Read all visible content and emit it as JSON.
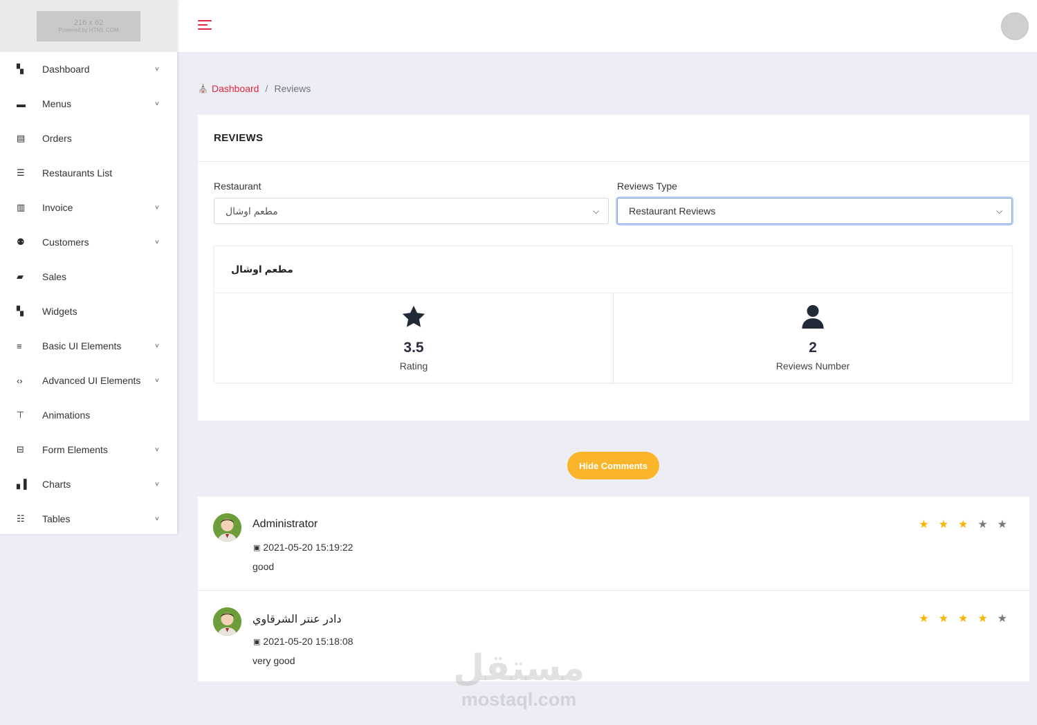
{
  "logo": {
    "line1": "216 x 62",
    "line2": "Powered by HTML.COM"
  },
  "sidebar": {
    "items": [
      {
        "label": "Dashboard",
        "icon": "dashboard-icon",
        "glyph": "▚",
        "chevron": true
      },
      {
        "label": "Menus",
        "icon": "archive-icon",
        "glyph": "▬",
        "chevron": true
      },
      {
        "label": "Orders",
        "icon": "clipboard-icon",
        "glyph": "▤",
        "chevron": false
      },
      {
        "label": "Restaurants List",
        "icon": "list-check-icon",
        "glyph": "☰",
        "chevron": false
      },
      {
        "label": "Invoice",
        "icon": "file-invoice-icon",
        "glyph": "▥",
        "chevron": true
      },
      {
        "label": "Customers",
        "icon": "users-icon",
        "glyph": "⚉",
        "chevron": true
      },
      {
        "label": "Sales",
        "icon": "briefcase-icon",
        "glyph": "▰",
        "chevron": false
      },
      {
        "label": "Widgets",
        "icon": "widgets-icon",
        "glyph": "▚",
        "chevron": false
      },
      {
        "label": "Basic UI Elements",
        "icon": "filter-icon",
        "glyph": "≡",
        "chevron": true
      },
      {
        "label": "Advanced UI Elements",
        "icon": "code-icon",
        "glyph": "‹›",
        "chevron": true
      },
      {
        "label": "Animations",
        "icon": "paint-roller-icon",
        "glyph": "⊤",
        "chevron": false
      },
      {
        "label": "Form Elements",
        "icon": "input-icon",
        "glyph": "⊟",
        "chevron": true
      },
      {
        "label": "Charts",
        "icon": "bar-chart-icon",
        "glyph": "▖▌",
        "chevron": true
      },
      {
        "label": "Tables",
        "icon": "sliders-icon",
        "glyph": "☷",
        "chevron": true
      }
    ]
  },
  "breadcrumb": {
    "home": "Dashboard",
    "current": "Reviews",
    "separator": "/"
  },
  "reviews_card": {
    "title": "REVIEWS",
    "restaurant_label": "Restaurant",
    "restaurant_value": "مطعم اوشال",
    "type_label": "Reviews Type",
    "type_value": "Restaurant Reviews",
    "restaurant_name": "مطعم اوشال",
    "rating_value": "3.5",
    "rating_label": "Rating",
    "reviews_count": "2",
    "reviews_count_label": "Reviews Number"
  },
  "hide_button": "Hide Comments",
  "comments": [
    {
      "name": "Administrator",
      "date": "2021-05-20 15:19:22",
      "text": "good",
      "stars": 3
    },
    {
      "name": "دادر عنتر الشرقاوي",
      "date": "2021-05-20 15:18:08",
      "text": "very good",
      "stars": 4
    }
  ],
  "watermark": {
    "arabic": "مستقل",
    "latin": "mostaql.com"
  },
  "colors": {
    "accent": "#e8243c",
    "button": "#fbb52a",
    "star": "#f8b600",
    "background": "#ecedf5"
  }
}
